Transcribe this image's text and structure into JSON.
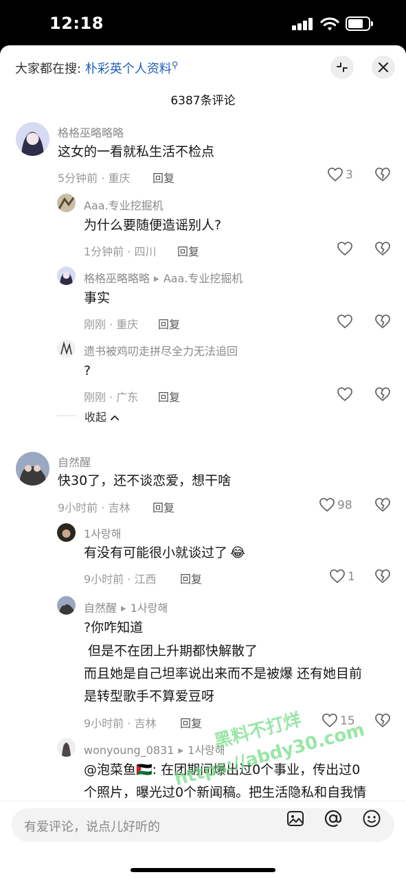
{
  "status": {
    "time": "12:18"
  },
  "header": {
    "prefix": "大家都在搜:",
    "keyword": "朴彩英个人资料",
    "search_icon": "search-icon",
    "collapse_icon": "collapse-icon",
    "close_icon": "close-icon"
  },
  "comment_count": "6387条评论",
  "comments": [
    {
      "user": "格格巫略略略",
      "text": "这女的一看就私生活不检点",
      "meta": "5分钟前 · 重庆",
      "reply": "回复",
      "likes": "3"
    },
    {
      "user": "Aaa.专业挖掘机",
      "text": "为什么要随便造谣别人?",
      "meta": "1分钟前 · 四川",
      "reply": "回复",
      "likes": ""
    },
    {
      "user": "格格巫略略略",
      "reply_to": "Aaa.专业挖掘机",
      "text": "事实",
      "meta": "刚刚 · 重庆",
      "reply": "回复",
      "likes": ""
    },
    {
      "user": "遗书被鸡叨走拼尽全力无法追回",
      "text": "?",
      "meta": "刚刚 · 广东",
      "reply": "回复",
      "likes": ""
    },
    {
      "user": "自然醒",
      "text": "快30了，还不谈恋爱，想干啥",
      "meta": "9小时前 · 吉林",
      "reply": "回复",
      "likes": "98"
    },
    {
      "user": "1사랑해",
      "text": "有没有可能很小就谈过了",
      "emoji": "😂",
      "meta": "9小时前 · 江西",
      "reply": "回复",
      "likes": "1"
    },
    {
      "user": "自然醒",
      "reply_to": "1사랑해",
      "lines": [
        "?你咋知道",
        " 但是不在团上升期都快解散了",
        "而且她是自己坦率说出来而不是被爆 还有她目前",
        "是转型歌手不算爱豆呀"
      ],
      "meta": "9小时前 · 吉林",
      "reply": "回复",
      "likes": "15"
    },
    {
      "user": "wonyoung_0831",
      "reply_to": "1사랑해",
      "lines": [
        "@泡菜鱼🇵🇸: 在团期间爆出过0个事业，传出过0",
        "个照片，曝光过0个新闻稿。把生活隐私和自我情"
      ]
    }
  ],
  "collapse_label": "收起",
  "watermark": {
    "line1": "黑料不打烊",
    "line2": "https://abdy30.com"
  },
  "input": {
    "placeholder": "有爱评论，说点儿好听的"
  }
}
